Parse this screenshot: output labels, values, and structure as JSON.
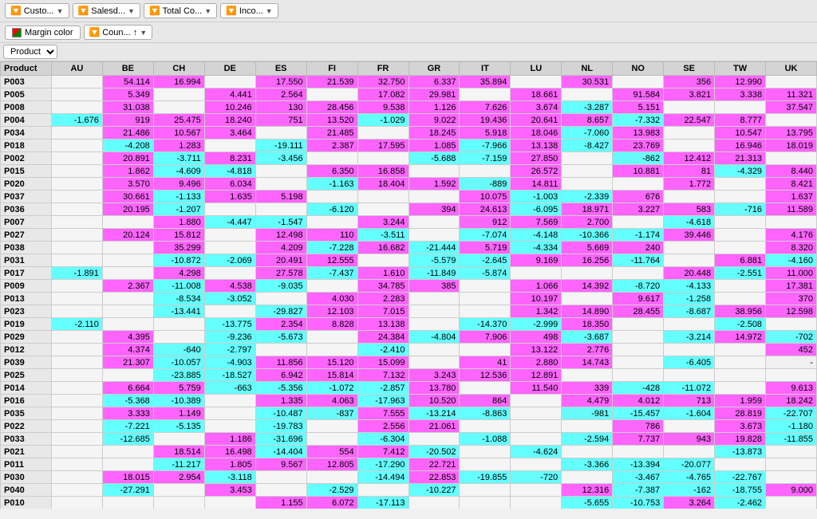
{
  "toolbars": {
    "filters": [
      {
        "label": "Custo...",
        "icon": "filter"
      },
      {
        "label": "Salesd...",
        "icon": "filter"
      },
      {
        "label": "Total Co...",
        "icon": "filter"
      },
      {
        "label": "Inco...",
        "icon": "filter"
      }
    ],
    "marginColor": "Margin color",
    "countryFilter": "Coun...",
    "productLabel": "Product"
  },
  "columns": [
    "Product",
    "AU",
    "BE",
    "CH",
    "DE",
    "ES",
    "FI",
    "FR",
    "GR",
    "IT",
    "LU",
    "NL",
    "NO",
    "SE",
    "TW",
    "UK"
  ],
  "rows": [
    {
      "id": "P003",
      "AU": "",
      "BE": "54.114",
      "CH": "16.994",
      "DE": "",
      "ES": "17.550",
      "FI": "21.539",
      "FR": "32.750",
      "GR": "6.337",
      "IT": "35.894",
      "LU": "",
      "NL": "30.531",
      "NO": "",
      "SE": "356",
      "TW": "12.990",
      "UK": ""
    },
    {
      "id": "P005",
      "AU": "",
      "BE": "5.349",
      "CH": "",
      "DE": "4.441",
      "ES": "2.564",
      "FI": "",
      "FR": "17.082",
      "GR": "29.981",
      "IT": "",
      "LU": "18.661",
      "NL": "",
      "NO": "91.584",
      "SE": "3.821",
      "TW": "3.338",
      "UK": "11.321"
    },
    {
      "id": "P008",
      "AU": "",
      "BE": "31.038",
      "CH": "",
      "DE": "10.246",
      "ES": "130",
      "FI": "28.456",
      "FR": "9.538",
      "GR": "1.126",
      "IT": "7.626",
      "LU": "3.674",
      "NL": "-3.287",
      "NO": "5.151",
      "SE": "",
      "TW": "",
      "UK": "37.547"
    },
    {
      "id": "P004",
      "AU": "-1.676",
      "BE": "919",
      "CH": "25.475",
      "DE": "18.240",
      "ES": "751",
      "FI": "13.520",
      "FR": "-1.029",
      "GR": "9.022",
      "IT": "19.436",
      "LU": "20.641",
      "NL": "8.657",
      "NO": "-7.332",
      "SE": "22.547",
      "TW": "8.777",
      "UK": ""
    },
    {
      "id": "P034",
      "AU": "",
      "BE": "21.486",
      "CH": "10.567",
      "DE": "3.464",
      "ES": "",
      "FI": "21.485",
      "FR": "",
      "GR": "18.245",
      "IT": "5.918",
      "LU": "18.046",
      "NL": "-7.060",
      "NO": "13.983",
      "SE": "",
      "TW": "10.547",
      "UK": "13.795"
    },
    {
      "id": "P018",
      "AU": "",
      "BE": "-4.208",
      "CH": "1.283",
      "DE": "",
      "ES": "-19.111",
      "FI": "2.387",
      "FR": "17.595",
      "GR": "1.085",
      "IT": "-7.966",
      "LU": "13.138",
      "NL": "-8.427",
      "NO": "23.769",
      "SE": "",
      "TW": "16.946",
      "UK": "18.019"
    },
    {
      "id": "P002",
      "AU": "",
      "BE": "20.891",
      "CH": "-3.711",
      "DE": "8.231",
      "ES": "-3.456",
      "FI": "",
      "FR": "",
      "GR": "-5.688",
      "IT": "-7.159",
      "LU": "27.850",
      "NL": "",
      "NO": "-862",
      "SE": "12.412",
      "TW": "21.313",
      "UK": ""
    },
    {
      "id": "P015",
      "AU": "",
      "BE": "1.862",
      "CH": "-4.609",
      "DE": "-4.818",
      "ES": "",
      "FI": "6.350",
      "FR": "16.858",
      "GR": "",
      "IT": "",
      "LU": "26.572",
      "NL": "",
      "NO": "10.881",
      "SE": "81",
      "TW": "-4.329",
      "UK": "8.440"
    },
    {
      "id": "P020",
      "AU": "",
      "BE": "3.570",
      "CH": "9.496",
      "DE": "6.034",
      "ES": "",
      "FI": "-1.163",
      "FR": "18.404",
      "GR": "1.592",
      "IT": "-889",
      "LU": "14.811",
      "NL": "",
      "NO": "",
      "SE": "1.772",
      "TW": "",
      "UK": "8.421"
    },
    {
      "id": "P037",
      "AU": "",
      "BE": "30.661",
      "CH": "-1.133",
      "DE": "1.635",
      "ES": "5.198",
      "FI": "",
      "FR": "",
      "GR": "",
      "IT": "10.075",
      "LU": "-1.003",
      "NL": "-2.339",
      "NO": "676",
      "SE": "",
      "TW": "",
      "UK": "1.637"
    },
    {
      "id": "P036",
      "AU": "",
      "BE": "20.195",
      "CH": "-1.207",
      "DE": "",
      "ES": "",
      "FI": "-6.120",
      "FR": "",
      "GR": "394",
      "IT": "24.613",
      "LU": "-6.095",
      "NL": "18.971",
      "NO": "3.227",
      "SE": "583",
      "TW": "-716",
      "UK": "11.589"
    },
    {
      "id": "P007",
      "AU": "",
      "BE": "",
      "CH": "1.880",
      "DE": "-4.447",
      "ES": "-1.547",
      "FI": "",
      "FR": "3.244",
      "GR": "",
      "IT": "912",
      "LU": "7.569",
      "NL": "2.700",
      "NO": "",
      "SE": "-4.618",
      "TW": "",
      "UK": ""
    },
    {
      "id": "P027",
      "AU": "",
      "BE": "20.124",
      "CH": "15.812",
      "DE": "",
      "ES": "12.498",
      "FI": "110",
      "FR": "-3.511",
      "GR": "",
      "IT": "-7.074",
      "LU": "-4.148",
      "NL": "-10.366",
      "NO": "-1.174",
      "SE": "39.446",
      "TW": "",
      "UK": "4.176"
    },
    {
      "id": "P038",
      "AU": "",
      "BE": "",
      "CH": "35.299",
      "DE": "",
      "ES": "4.209",
      "FI": "-7.228",
      "FR": "16.682",
      "GR": "-21.444",
      "IT": "5.719",
      "LU": "-4.334",
      "NL": "5.669",
      "NO": "240",
      "SE": "",
      "TW": "",
      "UK": "8.320"
    },
    {
      "id": "P031",
      "AU": "",
      "BE": "",
      "CH": "-10.872",
      "DE": "-2.069",
      "ES": "20.491",
      "FI": "12.555",
      "FR": "",
      "GR": "-5.579",
      "IT": "-2.645",
      "LU": "9.169",
      "NL": "16.256",
      "NO": "-11.764",
      "SE": "",
      "TW": "6.881",
      "UK": "-4.160"
    },
    {
      "id": "P017",
      "AU": "-1.891",
      "BE": "",
      "CH": "4.298",
      "DE": "",
      "ES": "27.578",
      "FI": "-7.437",
      "FR": "1.610",
      "GR": "-11.849",
      "IT": "-5.874",
      "LU": "",
      "NL": "",
      "NO": "",
      "SE": "20.448",
      "TW": "-2.551",
      "UK": "11.000"
    },
    {
      "id": "P009",
      "AU": "",
      "BE": "2.367",
      "CH": "-11.008",
      "DE": "4.538",
      "ES": "-9.035",
      "FI": "",
      "FR": "34.785",
      "GR": "385",
      "IT": "",
      "LU": "1.066",
      "NL": "14.392",
      "NO": "-8.720",
      "SE": "-4.133",
      "TW": "",
      "UK": "17.381"
    },
    {
      "id": "P013",
      "AU": "",
      "BE": "",
      "CH": "-8.534",
      "DE": "-3.052",
      "ES": "",
      "FI": "4.030",
      "FR": "2.283",
      "GR": "",
      "IT": "",
      "LU": "10.197",
      "NL": "",
      "NO": "9.617",
      "SE": "-1.258",
      "TW": "",
      "UK": "370"
    },
    {
      "id": "P023",
      "AU": "",
      "BE": "",
      "CH": "-13.441",
      "DE": "",
      "ES": "-29.827",
      "FI": "12.103",
      "FR": "7.015",
      "GR": "",
      "IT": "",
      "LU": "1.342",
      "NL": "14.890",
      "NO": "28.455",
      "SE": "-8.687",
      "TW": "38.956",
      "UK": "12.598"
    },
    {
      "id": "P019",
      "AU": "-2.110",
      "BE": "",
      "CH": "",
      "DE": "-13.775",
      "ES": "2.354",
      "FI": "8.828",
      "FR": "13.138",
      "GR": "",
      "IT": "-14.370",
      "LU": "-2.999",
      "NL": "18.350",
      "NO": "",
      "SE": "",
      "TW": "-2.508",
      "UK": ""
    },
    {
      "id": "P029",
      "AU": "",
      "BE": "4.395",
      "CH": "",
      "DE": "-9.236",
      "ES": "-5.673",
      "FI": "",
      "FR": "24.384",
      "GR": "-4.804",
      "IT": "7.906",
      "LU": "498",
      "NL": "-3.687",
      "NO": "",
      "SE": "-3.214",
      "TW": "14.972",
      "UK": "-702"
    },
    {
      "id": "P012",
      "AU": "",
      "BE": "4.374",
      "CH": "-640",
      "DE": "-2.797",
      "ES": "",
      "FI": "",
      "FR": "-2.410",
      "GR": "",
      "IT": "",
      "LU": "13.122",
      "NL": "2.776",
      "NO": "",
      "SE": "",
      "TW": "",
      "UK": "452"
    },
    {
      "id": "P039",
      "AU": "",
      "BE": "21.307",
      "CH": "-10.057",
      "DE": "-4.903",
      "ES": "11.856",
      "FI": "15.120",
      "FR": "15.099",
      "GR": "",
      "IT": "41",
      "LU": "2.880",
      "NL": "14.743",
      "NO": "",
      "SE": "-6.405",
      "TW": "",
      "UK": "-"
    },
    {
      "id": "P025",
      "AU": "",
      "BE": "",
      "CH": "-23.885",
      "DE": "-18.527",
      "ES": "6.942",
      "FI": "15.814",
      "FR": "7.132",
      "GR": "3.243",
      "IT": "12.536",
      "LU": "12.891",
      "NL": "",
      "NO": "",
      "SE": "",
      "TW": "",
      "UK": ""
    },
    {
      "id": "P014",
      "AU": "",
      "BE": "6.664",
      "CH": "5.759",
      "DE": "-663",
      "ES": "-5.356",
      "FI": "-1.072",
      "FR": "-2.857",
      "GR": "13.780",
      "IT": "",
      "LU": "11.540",
      "NL": "339",
      "NO": "-428",
      "SE": "-11.072",
      "TW": "",
      "UK": "9.613"
    },
    {
      "id": "P016",
      "AU": "",
      "BE": "-5.368",
      "CH": "-10.389",
      "DE": "",
      "ES": "1.335",
      "FI": "4.063",
      "FR": "-17.963",
      "GR": "10.520",
      "IT": "864",
      "LU": "",
      "NL": "4.479",
      "NO": "4.012",
      "SE": "713",
      "TW": "1.959",
      "UK": "18.242"
    },
    {
      "id": "P035",
      "AU": "",
      "BE": "3.333",
      "CH": "1.149",
      "DE": "",
      "ES": "-10.487",
      "FI": "-837",
      "FR": "7.555",
      "GR": "-13.214",
      "IT": "-8.863",
      "LU": "",
      "NL": "-981",
      "NO": "-15.457",
      "SE": "-1.604",
      "TW": "28.819",
      "UK": "-22.707"
    },
    {
      "id": "P022",
      "AU": "",
      "BE": "-7.221",
      "CH": "-5.135",
      "DE": "",
      "ES": "-19.783",
      "FI": "",
      "FR": "2.556",
      "GR": "21.061",
      "IT": "",
      "LU": "",
      "NL": "",
      "NO": "786",
      "SE": "",
      "TW": "3.673",
      "UK": "-1.180"
    },
    {
      "id": "P033",
      "AU": "",
      "BE": "-12.685",
      "CH": "",
      "DE": "1.186",
      "ES": "-31.696",
      "FI": "",
      "FR": "-6.304",
      "GR": "",
      "IT": "-1.088",
      "LU": "",
      "NL": "-2.594",
      "NO": "7.737",
      "SE": "943",
      "TW": "19.828",
      "UK": "-11.855"
    },
    {
      "id": "P021",
      "AU": "",
      "BE": "",
      "CH": "18.514",
      "DE": "16.498",
      "ES": "-14.404",
      "FI": "554",
      "FR": "7.412",
      "GR": "-20.502",
      "IT": "",
      "LU": "-4.624",
      "NL": "",
      "NO": "",
      "SE": "",
      "TW": "-13.873",
      "UK": ""
    },
    {
      "id": "P011",
      "AU": "",
      "BE": "",
      "CH": "-11.217",
      "DE": "1.805",
      "ES": "9.567",
      "FI": "12.805",
      "FR": "-17.290",
      "GR": "22.721",
      "IT": "",
      "LU": "",
      "NL": "-3.366",
      "NO": "-13.394",
      "SE": "-20.077",
      "TW": "",
      "UK": ""
    },
    {
      "id": "P030",
      "AU": "",
      "BE": "18.015",
      "CH": "2.954",
      "DE": "-3.118",
      "ES": "",
      "FI": "",
      "FR": "-14.494",
      "GR": "22.853",
      "IT": "-19.855",
      "LU": "-720",
      "NL": "",
      "NO": "-3.467",
      "SE": "-4.765",
      "TW": "-22.767",
      "UK": ""
    },
    {
      "id": "P040",
      "AU": "",
      "BE": "-27.291",
      "CH": "",
      "DE": "3.453",
      "ES": "",
      "FI": "-2.529",
      "FR": "",
      "GR": "-10.227",
      "IT": "",
      "LU": "",
      "NL": "12.316",
      "NO": "-7.387",
      "SE": "-162",
      "TW": "-18.755",
      "UK": "9.000"
    },
    {
      "id": "P010",
      "AU": "",
      "BE": "",
      "CH": "",
      "DE": "",
      "ES": "1.155",
      "FI": "6.072",
      "FR": "-17.113",
      "GR": "",
      "IT": "",
      "LU": "",
      "NL": "-5.655",
      "NO": "-10.753",
      "SE": "3.264",
      "TW": "-2.462",
      "UK": ""
    }
  ]
}
